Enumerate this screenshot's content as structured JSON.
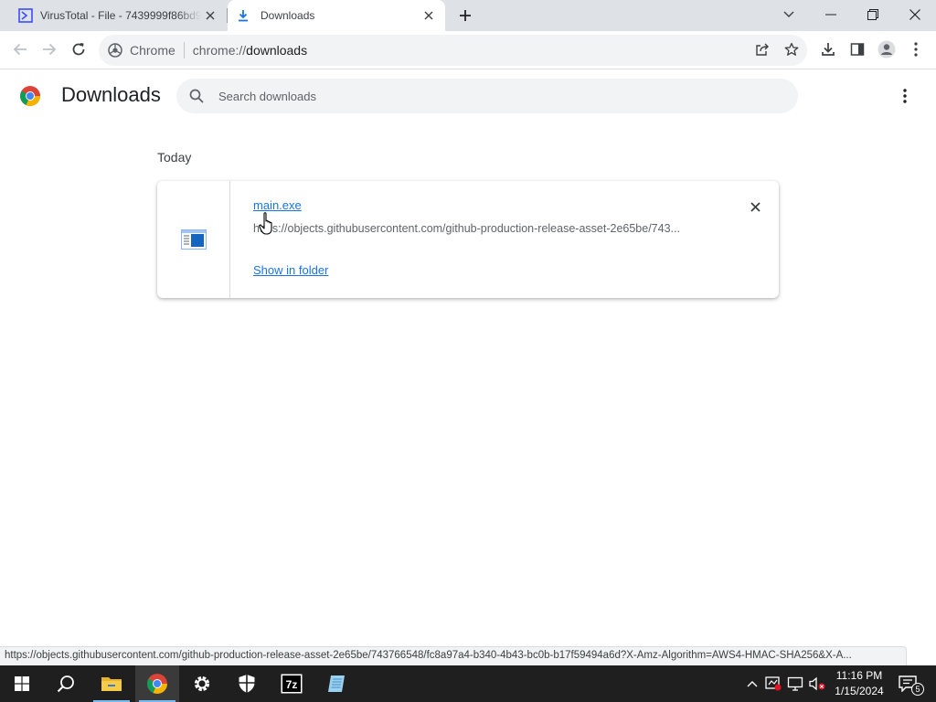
{
  "tabs": [
    {
      "title": "VirusTotal - File - 7439999f86bd9",
      "active": false
    },
    {
      "title": "Downloads",
      "active": true
    }
  ],
  "omnibox": {
    "site_label": "Chrome",
    "url_scheme": "chrome://",
    "url_host": "downloads"
  },
  "page": {
    "title": "Downloads",
    "search_placeholder": "Search downloads",
    "date_heading": "Today"
  },
  "download": {
    "file_name": "main.exe",
    "url": "https://objects.githubusercontent.com/github-production-release-asset-2e65be/743...",
    "show_in_folder": "Show in folder"
  },
  "status_bubble": "https://objects.githubusercontent.com/github-production-release-asset-2e65be/743766548/fc8a97a4-b340-4b43-bc0b-b17f59494a6d?X-Amz-Algorithm=AWS4-HMAC-SHA256&X-A...",
  "taskbar": {
    "clock_time": "11:16 PM",
    "clock_date": "1/15/2024",
    "notification_count": "5",
    "apps": [
      "start",
      "search",
      "file-explorer",
      "chrome",
      "settings",
      "windows-security",
      "7-zip",
      "notepad"
    ]
  },
  "colors": {
    "accent": "#1a73e8",
    "tabstrip_bg": "#dee1e6",
    "taskbar_bg": "#1f1f1f"
  }
}
